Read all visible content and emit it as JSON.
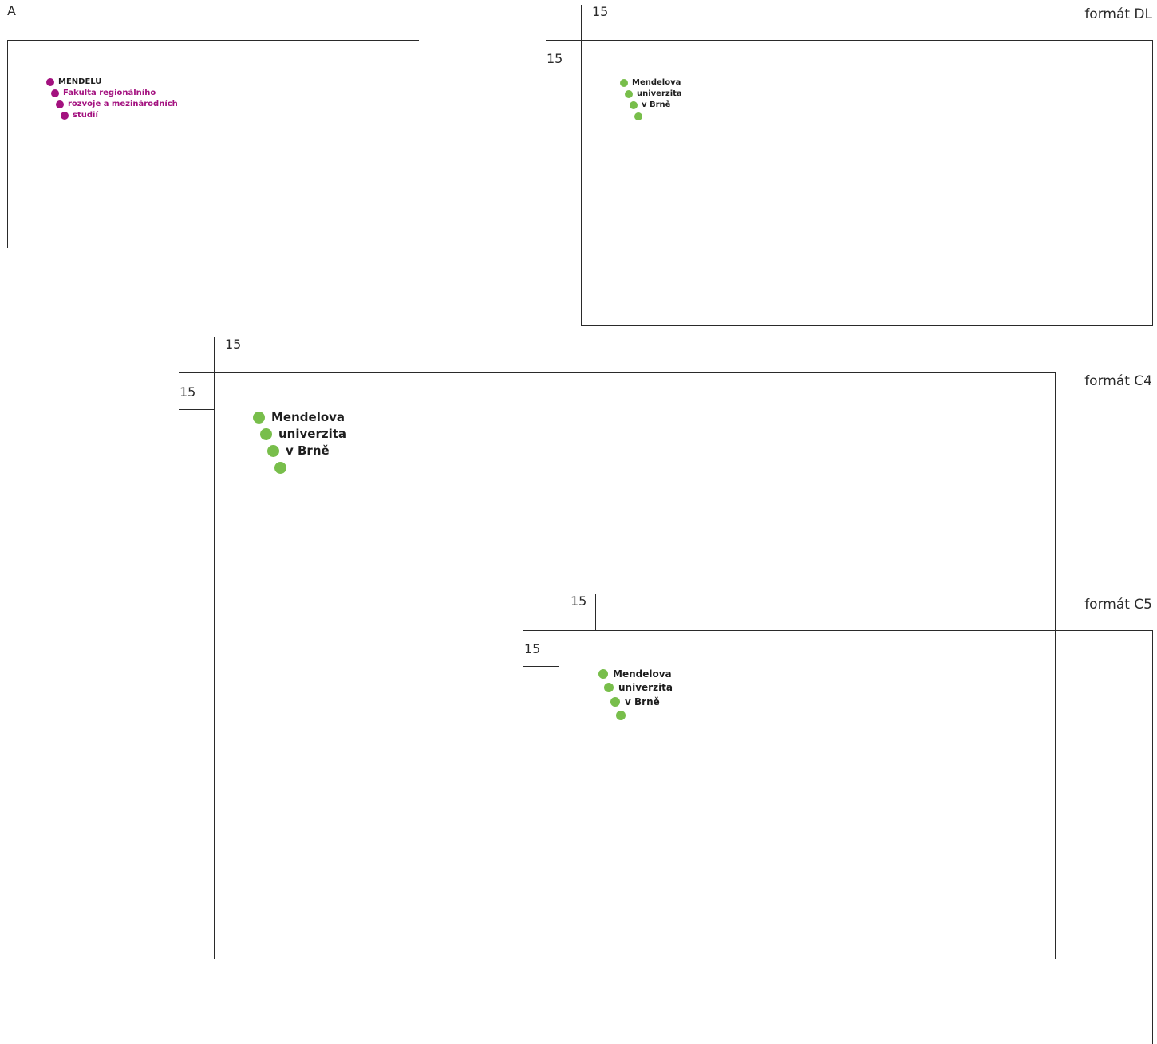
{
  "colors": {
    "mendelu_purple": "#A3117F",
    "mendelu_green": "#78BE4B",
    "text_dark": "#1e1e1e",
    "line": "#2a2a2a"
  },
  "panel_a": {
    "label": "A",
    "logo": [
      "MENDELU",
      "Fakulta regionálního",
      "rozvoje a mezinárodních",
      "studií"
    ]
  },
  "format_dl": {
    "title": "formát DL",
    "margin_top": "15",
    "margin_left": "15",
    "logo": [
      "Mendelova",
      "univerzita",
      "v Brně",
      ""
    ]
  },
  "format_c4": {
    "title": "formát C4",
    "margin_top": "15",
    "margin_left": "15",
    "logo": [
      "Mendelova",
      "univerzita",
      "v Brně",
      ""
    ]
  },
  "format_c5": {
    "title": "formát C5",
    "margin_top": "15",
    "margin_left": "15",
    "logo": [
      "Mendelova",
      "univerzita",
      "v Brně",
      ""
    ]
  }
}
